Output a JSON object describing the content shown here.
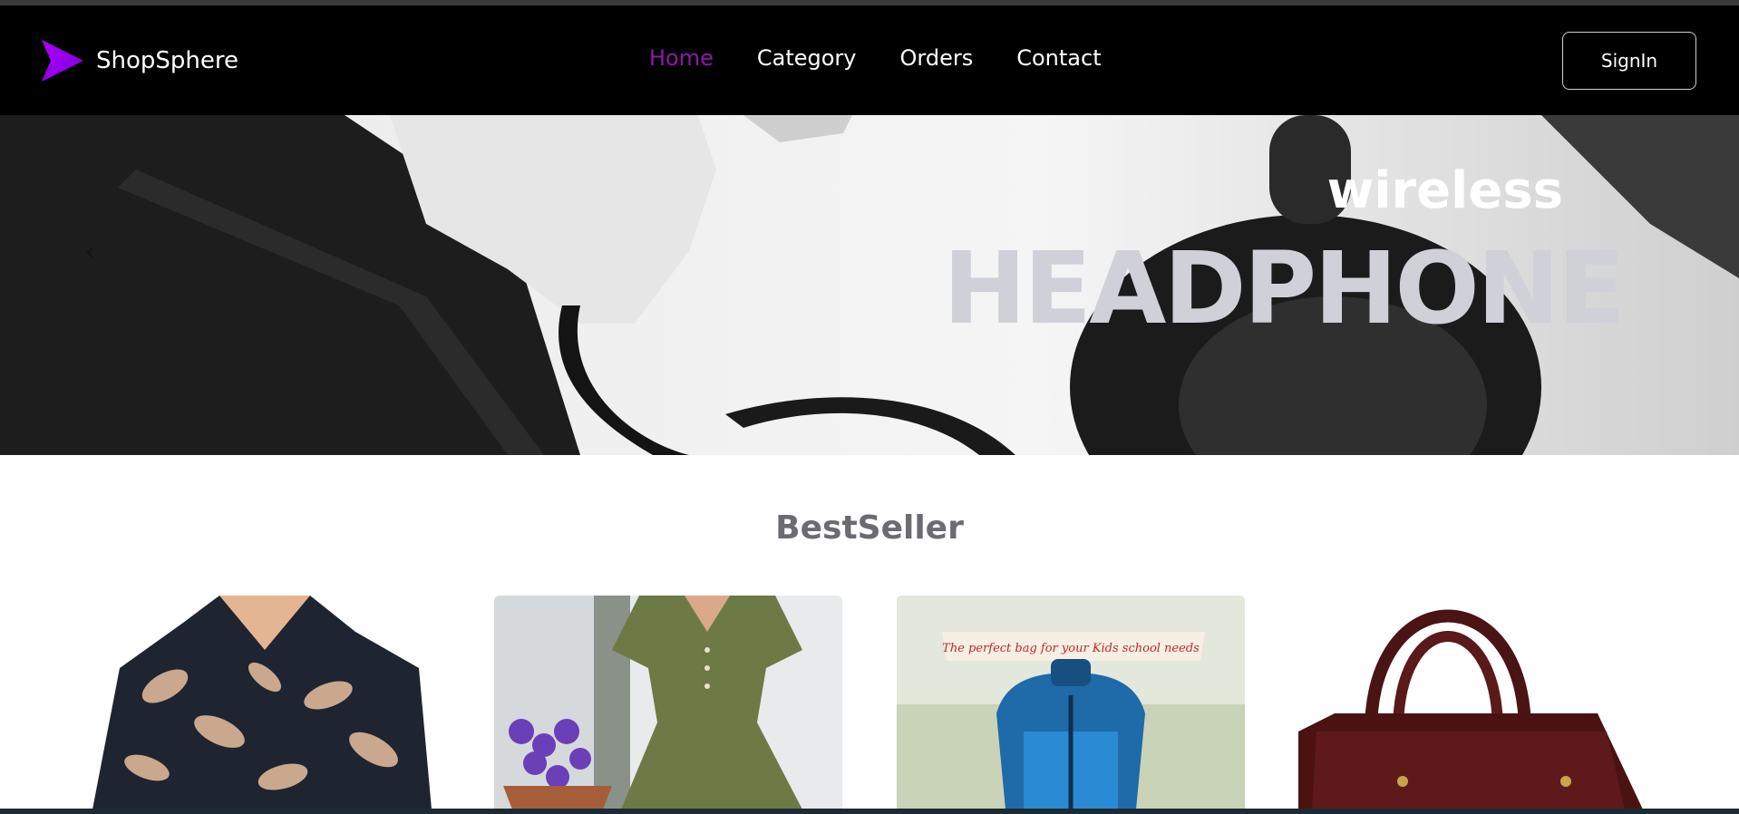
{
  "brand": {
    "name": "ShopSphere"
  },
  "nav": {
    "links": [
      "Home",
      "Category",
      "Orders",
      "Contact"
    ],
    "active": "Home"
  },
  "header": {
    "signin_label": "SignIn"
  },
  "hero": {
    "prev_glyph": "‹",
    "subtitle": "wireless",
    "title": "HEADPHONE"
  },
  "bestseller": {
    "title": "BestSeller",
    "items": [
      {
        "name": "floral shirt"
      },
      {
        "name": "green dress"
      },
      {
        "name": "school backpack",
        "caption": "The perfect bag for your Kids school needs"
      },
      {
        "name": "leather handbag"
      }
    ]
  },
  "colors": {
    "accent": "#8c1aa8",
    "navbar": "#000000",
    "hero_title": "#cfd0d8"
  }
}
